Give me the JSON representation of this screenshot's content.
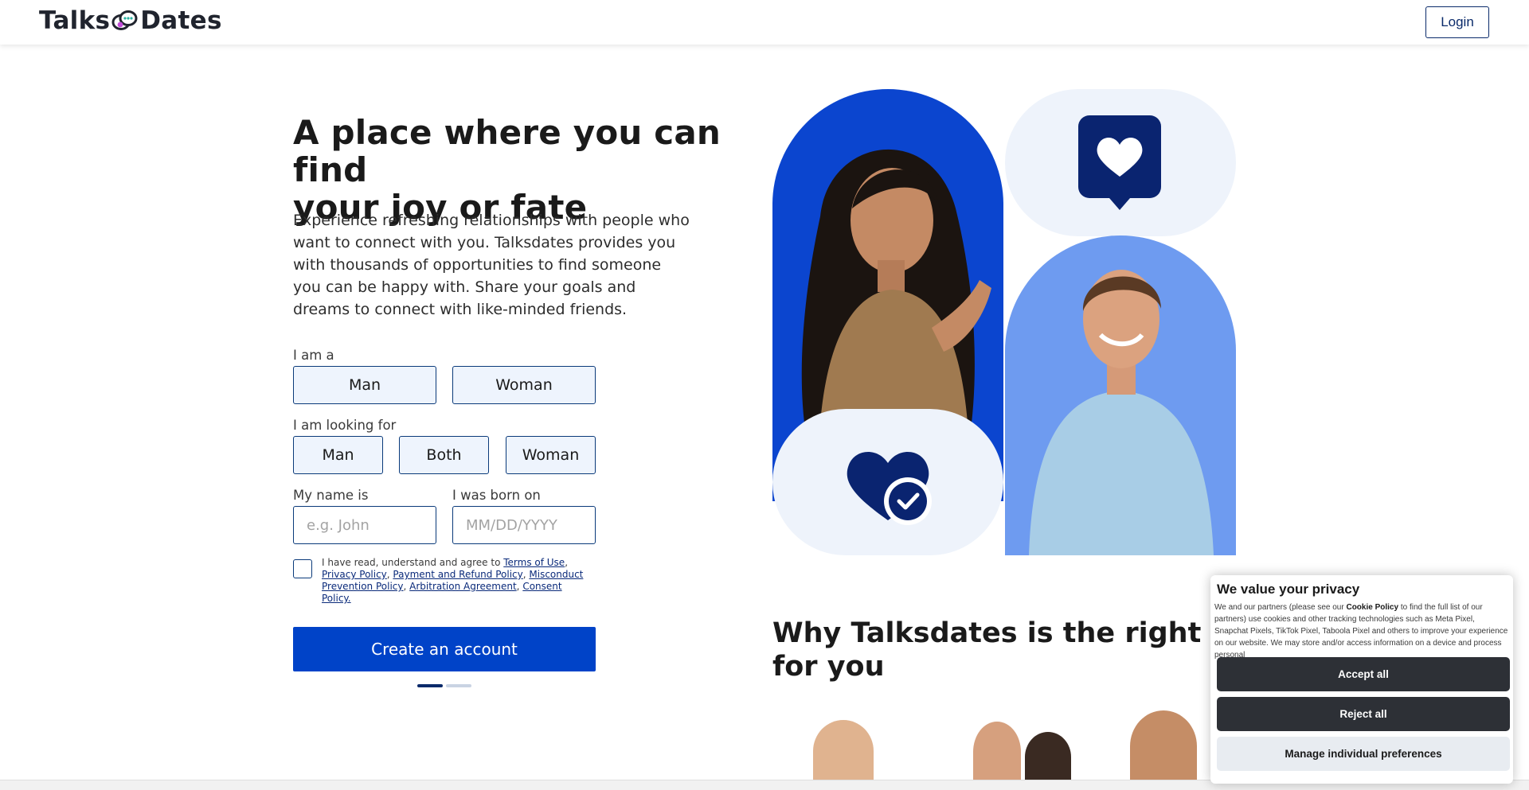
{
  "header": {
    "logo_left": "Talks",
    "logo_right": "Dates",
    "login_label": "Login"
  },
  "hero": {
    "title_line1": "A place where you can find",
    "title_line2": "your joy or fate",
    "description": "Experience refreshing relationships with people who want to connect with you. Talksdates provides you with thousands of opportunities to find someone you can be happy with. Share your goals and dreams to connect with like-minded friends."
  },
  "form": {
    "i_am_label": "I am a",
    "i_am_options": [
      "Man",
      "Woman"
    ],
    "looking_for_label": "I am looking for",
    "looking_for_options": [
      "Man",
      "Both",
      "Woman"
    ],
    "name_label": "My name is",
    "name_placeholder": "e.g. John",
    "born_label": "I was born on",
    "born_placeholder": "MM/DD/YYYY",
    "terms_intro": "I have read, understand and agree to ",
    "terms_links": [
      "Terms of Use",
      "Privacy Policy",
      "Payment and Refund Policy",
      "Misconduct Prevention Policy",
      "Arbitration Agreement",
      "Consent Policy."
    ],
    "cta_label": "Create an account"
  },
  "why": {
    "title_line1": "Why Talksdates is the right match",
    "title_line2": "for you"
  },
  "cookie": {
    "title": "We value your privacy",
    "text_before": "We and our partners (please see our ",
    "text_link": "Cookie Policy",
    "text_after": " to find the full list of our partners) use cookies and other tracking technologies such as Meta Pixel, Snapchat Pixels, TikTok Pixel, Taboola Pixel and others to improve your experience on our website. We may store and/or access information on a device and process personal",
    "accept_label": "Accept all",
    "reject_label": "Reject all",
    "manage_label": "Manage individual preferences"
  },
  "colors": {
    "brand_blue": "#0043c8",
    "navy": "#0a2a6a",
    "tile_blue": "#0b45cf",
    "tile_light_blue": "#6e9bf0",
    "tile_pale": "#eef3fb"
  },
  "icons": [
    "chat-bubbles-logo-icon",
    "heart-bubble-icon",
    "heart-check-icon"
  ]
}
